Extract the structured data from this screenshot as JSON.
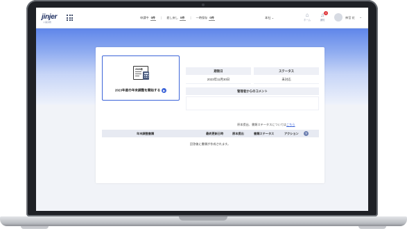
{
  "header": {
    "logo": "jinjer",
    "logo_sub": "人事労務",
    "stats": [
      {
        "label": "申請中",
        "count": "0件"
      },
      {
        "label": "差し戻し",
        "count": "0件"
      },
      {
        "label": "一時保存",
        "count": "0件"
      }
    ],
    "company": "本社",
    "nav_home": "ホーム",
    "nav_notice": "通知",
    "notice_badge": "4",
    "user_name": "神宮 花"
  },
  "start_card": {
    "doc_title": "2023年",
    "label": "2023年度の年末調整を開始する"
  },
  "info": {
    "deadline_label": "期限日",
    "deadline_value": "2023年11月30日",
    "status_label": "ステータス",
    "status_value": "未対応",
    "comment_label": "管理者からのコメント",
    "comment_value": ""
  },
  "notice": {
    "text": "原本提出、書類ステータスについては",
    "link": "こちら"
  },
  "table": {
    "columns": [
      "年末調整書類",
      "最終更新日時",
      "原本提出",
      "書類ステータス",
      "アクション"
    ],
    "help_icon": "?",
    "empty_message": "回答後に書類が作成されます。"
  },
  "icons": [
    "apps-grid-icon",
    "home-icon",
    "bell-icon",
    "avatar-icon",
    "play-icon",
    "document-icon",
    "calculator-icon",
    "help-icon"
  ],
  "colors": {
    "accent": "#3b63d8",
    "hero_top": "#5f86ea",
    "badge": "#e0393e"
  }
}
